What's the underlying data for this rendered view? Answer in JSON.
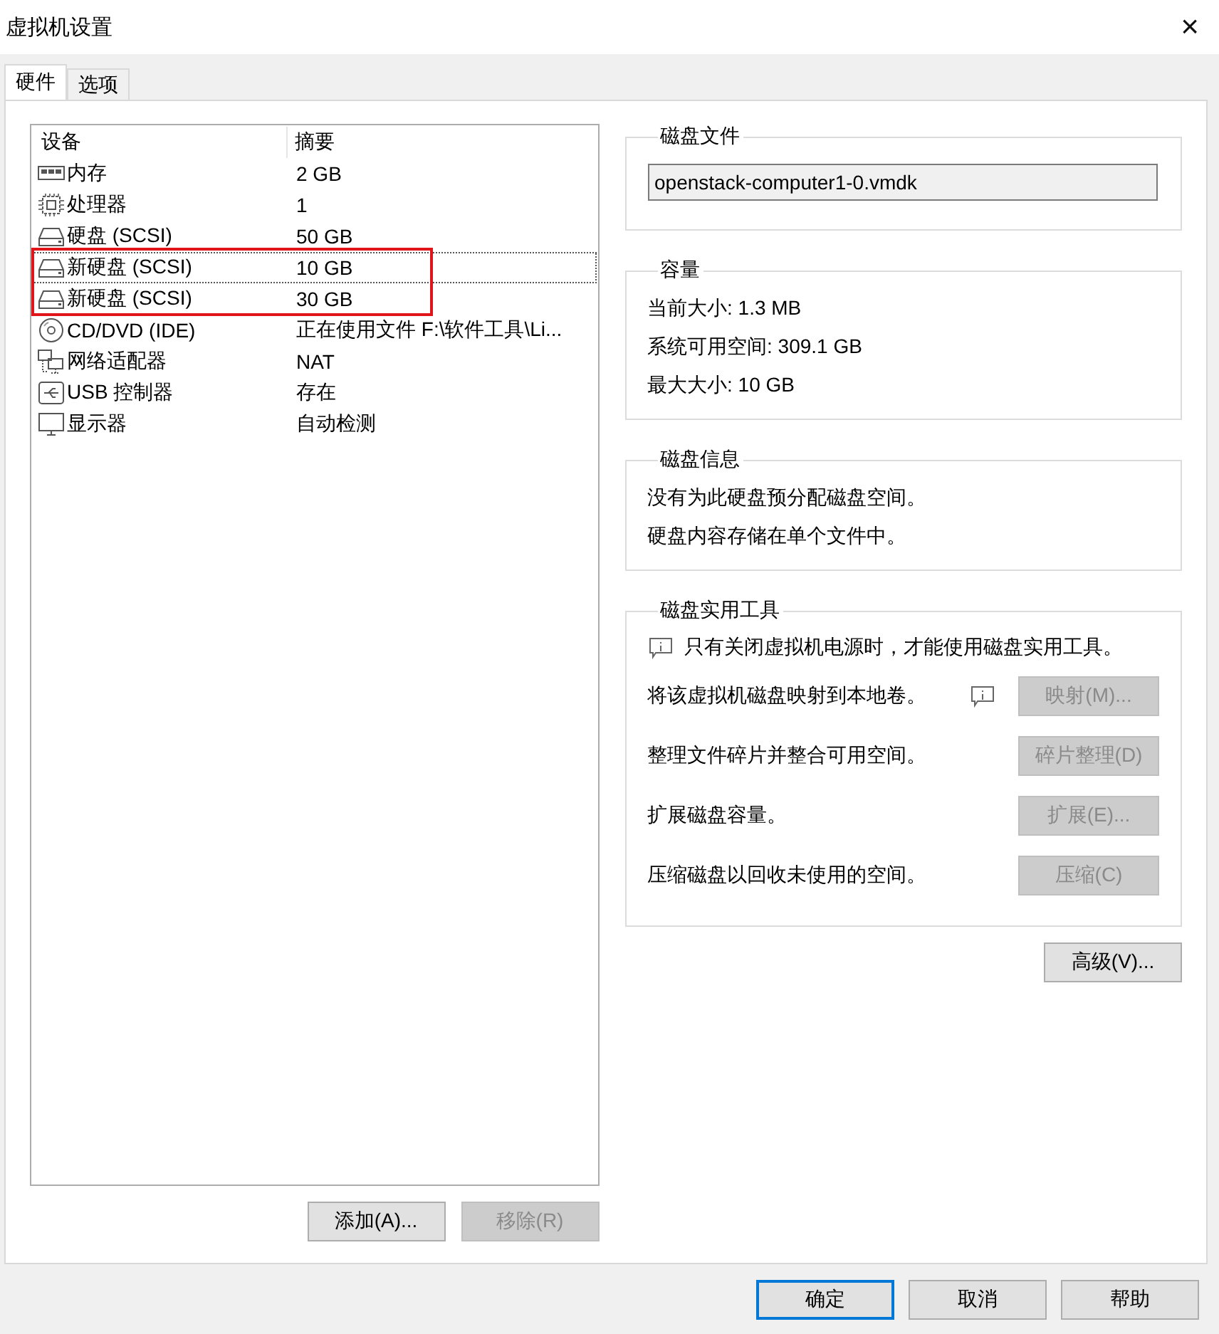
{
  "window": {
    "title": "虚拟机设置",
    "close": "×"
  },
  "tabs": [
    {
      "label": "硬件",
      "selected": true
    },
    {
      "label": "选项",
      "selected": false
    }
  ],
  "devices": {
    "columns": [
      "设备",
      "摘要"
    ],
    "rows": [
      {
        "kind": "memory",
        "name": "内存",
        "summary": "2 GB",
        "selected": false,
        "highlighted": false
      },
      {
        "kind": "cpu",
        "name": "处理器",
        "summary": "1",
        "selected": false,
        "highlighted": false
      },
      {
        "kind": "disk",
        "name": "硬盘 (SCSI)",
        "summary": "50 GB",
        "selected": false,
        "highlighted": false
      },
      {
        "kind": "disk",
        "name": "新硬盘 (SCSI)",
        "summary": "10 GB",
        "selected": true,
        "highlighted": true
      },
      {
        "kind": "disk",
        "name": "新硬盘 (SCSI)",
        "summary": "30 GB",
        "selected": false,
        "highlighted": true
      },
      {
        "kind": "cd",
        "name": "CD/DVD (IDE)",
        "summary": "正在使用文件 F:\\软件工具\\Li...",
        "selected": false,
        "highlighted": false
      },
      {
        "kind": "network",
        "name": "网络适配器",
        "summary": "NAT",
        "selected": false,
        "highlighted": false
      },
      {
        "kind": "usb",
        "name": "USB 控制器",
        "summary": "存在",
        "selected": false,
        "highlighted": false
      },
      {
        "kind": "monitor",
        "name": "显示器",
        "summary": "自动检测",
        "selected": false,
        "highlighted": false
      }
    ],
    "buttons": [
      {
        "label": "添加(A)...",
        "disabled": false
      },
      {
        "label": "移除(R)",
        "disabled": true
      }
    ]
  },
  "disk_file": {
    "title": "磁盘文件",
    "value": "openstack-computer1-0.vmdk"
  },
  "capacity": {
    "title": "容量",
    "lines": [
      "当前大小: 1.3 MB",
      "系统可用空间: 309.1 GB",
      "最大大小: 10 GB"
    ]
  },
  "disk_info": {
    "title": "磁盘信息",
    "lines": [
      "没有为此硬盘预分配磁盘空间。",
      "硬盘内容存储在单个文件中。"
    ]
  },
  "disk_utilities": {
    "title": "磁盘实用工具",
    "note": "只有关闭虚拟机电源时，才能使用磁盘实用工具。",
    "actions": [
      {
        "text": "将该虚拟机磁盘映射到本地卷。",
        "info": true,
        "button": "映射(M)...",
        "disabled": true
      },
      {
        "text": "整理文件碎片并整合可用空间。",
        "info": false,
        "button": "碎片整理(D)",
        "disabled": true
      },
      {
        "text": "扩展磁盘容量。",
        "info": false,
        "button": "扩展(E)...",
        "disabled": true
      },
      {
        "text": "压缩磁盘以回收未使用的空间。",
        "info": false,
        "button": "压缩(C)",
        "disabled": true
      }
    ]
  },
  "advanced_button": {
    "label": "高级(V)...",
    "disabled": false
  },
  "footer_buttons": [
    {
      "label": "确定",
      "default": true
    },
    {
      "label": "取消",
      "default": false
    },
    {
      "label": "帮助",
      "default": false
    }
  ]
}
